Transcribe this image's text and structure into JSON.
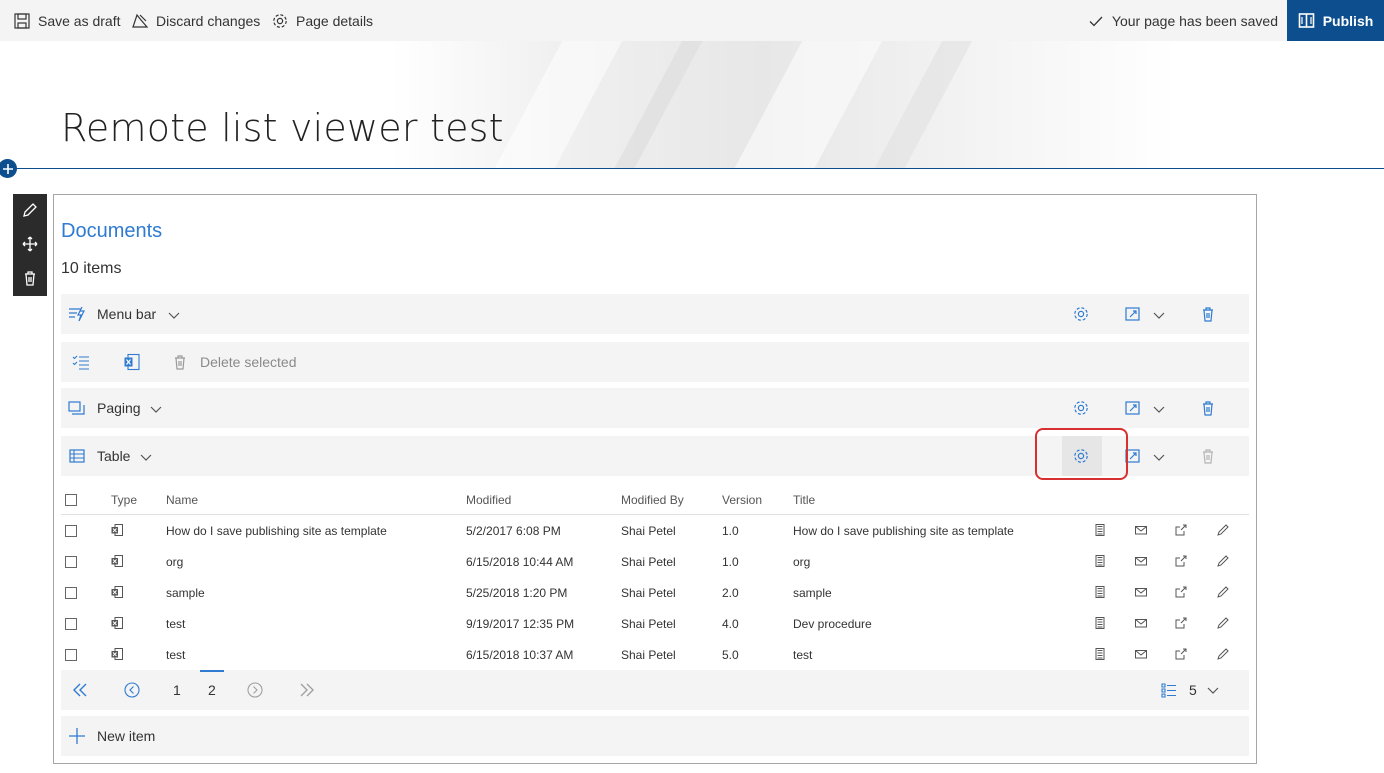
{
  "command_bar": {
    "save_draft": "Save as draft",
    "discard": "Discard changes",
    "page_details": "Page details",
    "saved_status": "Your page has been saved",
    "publish": "Publish"
  },
  "page": {
    "title": "Remote list viewer test"
  },
  "webpart": {
    "title": "Documents",
    "count": "10 items",
    "menu_bar_label": "Menu bar",
    "delete_selected": "Delete selected",
    "paging_label": "Paging",
    "table_label": "Table",
    "new_item": "New item"
  },
  "table": {
    "headers": [
      "Type",
      "Name",
      "Modified",
      "Modified By",
      "Version",
      "Title"
    ],
    "rows": [
      {
        "name": "How do I save publishing site as template",
        "modified": "5/2/2017 6:08 PM",
        "modified_by": "Shai Petel",
        "version": "1.0",
        "title": "How do I save publishing site as template"
      },
      {
        "name": "org",
        "modified": "6/15/2018 10:44 AM",
        "modified_by": "Shai Petel",
        "version": "1.0",
        "title": "org"
      },
      {
        "name": "sample",
        "modified": "5/25/2018 1:20 PM",
        "modified_by": "Shai Petel",
        "version": "2.0",
        "title": "sample"
      },
      {
        "name": "test",
        "modified": "9/19/2017 12:35 PM",
        "modified_by": "Shai Petel",
        "version": "4.0",
        "title": "Dev procedure"
      },
      {
        "name": "test",
        "modified": "6/15/2018 10:37 AM",
        "modified_by": "Shai Petel",
        "version": "5.0",
        "title": "test"
      }
    ]
  },
  "pager": {
    "page1": "1",
    "page2": "2",
    "page_size": "5"
  },
  "colors": {
    "accent": "#0d4e8f",
    "link": "#2f7bd1",
    "highlight": "#d83030"
  },
  "icons": [
    "save-icon",
    "discard-icon",
    "gear-icon",
    "check-icon",
    "book-icon",
    "pencil-icon",
    "move-icon",
    "trash-icon",
    "menu-bar-icon",
    "checklist-icon",
    "excel-icon",
    "paging-icon",
    "table-icon",
    "layout-icon",
    "chevron-down-icon",
    "doc-icon",
    "mail-icon",
    "share-icon",
    "first-page-icon",
    "prev-page-icon",
    "next-page-icon",
    "last-page-icon",
    "page-size-icon",
    "plus-icon"
  ]
}
